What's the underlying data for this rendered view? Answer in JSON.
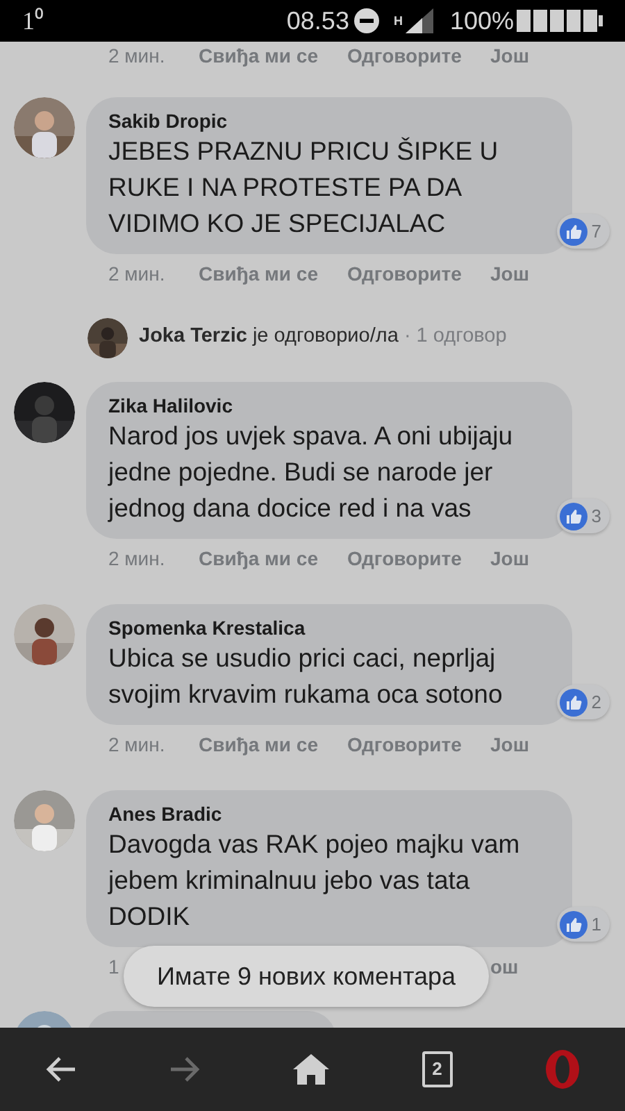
{
  "status_bar": {
    "notification": "1⁰",
    "time": "08.53",
    "network": "H",
    "battery": "100%"
  },
  "top_actions": [
    {
      "kind": "time",
      "label": "2 мин."
    },
    {
      "kind": "like",
      "label": "Свиђа ми се"
    },
    {
      "kind": "reply",
      "label": "Одговорите"
    },
    {
      "kind": "more",
      "label": "Још"
    }
  ],
  "comments": [
    {
      "author": "Sakib Dropic",
      "text": "JEBES PRAZNU PRICU ŠIPKE U RUKE I NA PROTESTE PA DA VIDIMO KO JE SPECIJALAC",
      "reactions": "7",
      "actions": [
        {
          "kind": "time",
          "label": "2 мин."
        },
        {
          "kind": "like",
          "label": "Свиђа ми се"
        },
        {
          "kind": "reply",
          "label": "Одговорите"
        },
        {
          "kind": "more",
          "label": "Још"
        }
      ],
      "reply_summary": {
        "author": "Joka Terzic",
        "verb": "је одговорио/ла",
        "count": "· 1 одговор"
      }
    },
    {
      "author": "Zika Halilovic",
      "text": "Narod jos uvjek spava. A oni ubijaju jedne pojedne. Budi se narode jer jednog dana docice red i na vas",
      "reactions": "3",
      "actions": [
        {
          "kind": "time",
          "label": "2 мин."
        },
        {
          "kind": "like",
          "label": "Свиђа ми се"
        },
        {
          "kind": "reply",
          "label": "Одговорите"
        },
        {
          "kind": "more",
          "label": "Још"
        }
      ]
    },
    {
      "author": "Spomenka Krestalica",
      "text": "Ubica se usudio prici caci, neprljaj svojim krvavim rukama oca sotono",
      "reactions": "2",
      "actions": [
        {
          "kind": "time",
          "label": "2 мин."
        },
        {
          "kind": "like",
          "label": "Свиђа ми се"
        },
        {
          "kind": "reply",
          "label": "Одговорите"
        },
        {
          "kind": "more",
          "label": "Још"
        }
      ]
    },
    {
      "author": "Anes Bradic",
      "text": "Davogda vas RAK pojeo majku vam jebem kriminalnuu jebo vas tata DODIK",
      "reactions": "1",
      "actions": [
        {
          "kind": "time",
          "label": "1"
        },
        {
          "kind": "more",
          "label": "ош"
        }
      ]
    }
  ],
  "toast": "Имате 9 нових коментара",
  "nav": {
    "tabs_count": "2"
  }
}
